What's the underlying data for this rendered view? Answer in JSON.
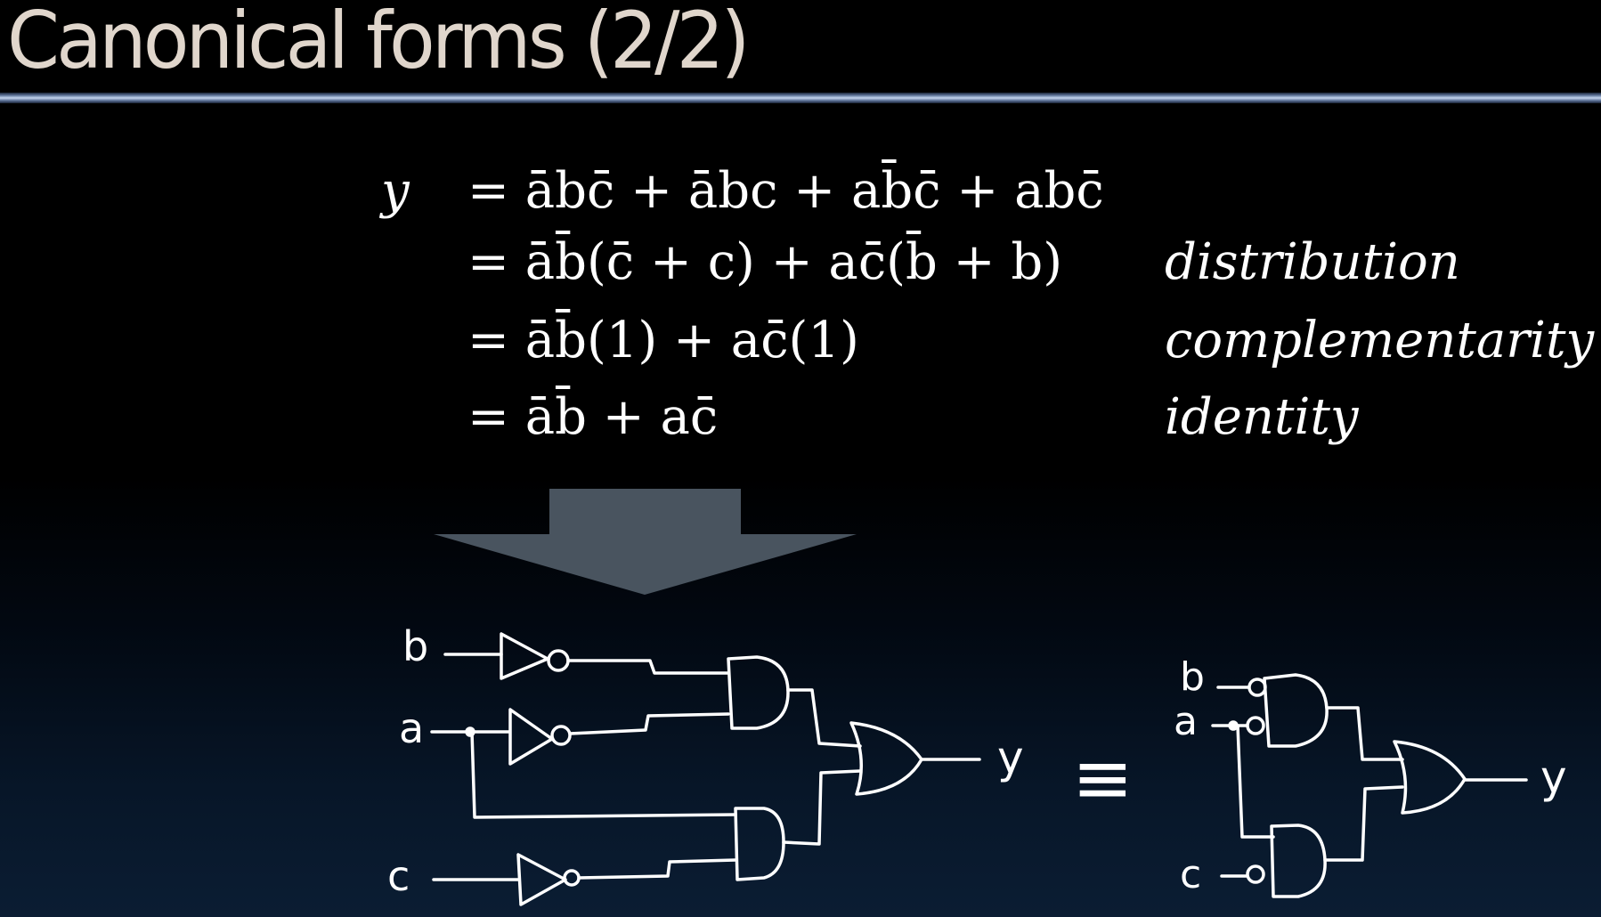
{
  "slide": {
    "title": "Canonical forms (2/2)",
    "derivation": {
      "lhs": "y",
      "rows": [
        {
          "expr": "= ābc̄ + ābc + ab̄c̄ + abc̄",
          "justification": ""
        },
        {
          "expr": "= āb̄(c̄ + c) + ac̄(b̄ + b)",
          "justification": "distribution"
        },
        {
          "expr": "= āb̄(1) + ac̄(1)",
          "justification": "complementarity"
        },
        {
          "expr": "= āb̄ + ac̄",
          "justification": "identity"
        }
      ]
    },
    "circuit_left": {
      "inputs": [
        "b",
        "a",
        "c"
      ],
      "output": "y"
    },
    "equivalence_symbol": "≡",
    "circuit_right": {
      "inputs": [
        "b",
        "a",
        "c"
      ],
      "output": "y"
    }
  },
  "colors": {
    "title": "#e0d6cc",
    "arrow": "#49545f",
    "ink": "#ffffff"
  }
}
